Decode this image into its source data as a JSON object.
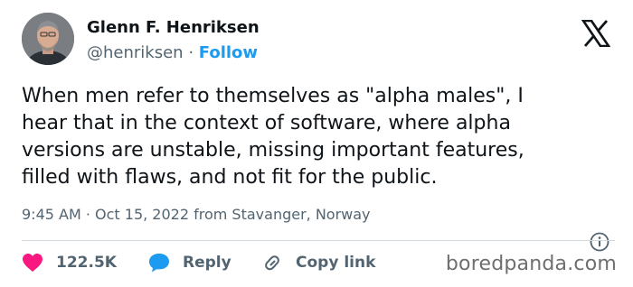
{
  "author": {
    "name": "Glenn F. Henriksen",
    "handle": "@henriksen",
    "separator": "·",
    "follow_label": "Follow"
  },
  "tweet": {
    "lines": [
      "When men refer to themselves as \"alpha males\", I",
      "hear that in the context of software, where alpha",
      "versions are unstable, missing important features,",
      "filled with flaws, and not fit for the public."
    ],
    "timestamp": "9:45 AM · Oct 15, 2022 from Stavanger, Norway"
  },
  "actions": {
    "like_count": "122.5K",
    "reply_label": "Reply",
    "copy_label": "Copy link"
  },
  "watermark": "boredpanda.com",
  "colors": {
    "accent": "#1d9bf0",
    "like": "#f91880",
    "text": "#0f1419",
    "muted": "#536471"
  },
  "icons": [
    "avatar",
    "x-logo-icon",
    "info-icon",
    "heart-icon",
    "reply-bubble-icon",
    "link-icon"
  ]
}
